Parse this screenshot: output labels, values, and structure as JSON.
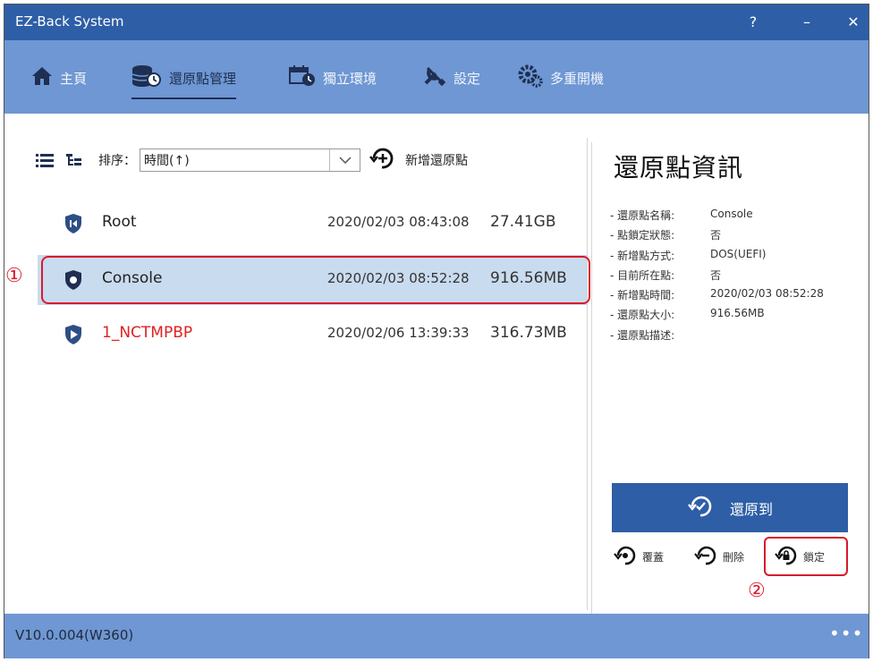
{
  "window": {
    "title": "EZ-Back System",
    "help_label": "?",
    "minimize_label": "–",
    "close_label": "✕"
  },
  "nav": {
    "items": [
      {
        "label": "主頁",
        "icon": "home-icon"
      },
      {
        "label": "還原點管理",
        "icon": "database-restore-icon"
      },
      {
        "label": "獨立環境",
        "icon": "calendar-icon"
      },
      {
        "label": "設定",
        "icon": "tools-icon"
      },
      {
        "label": "多重開機",
        "icon": "gears-icon"
      }
    ],
    "active": "還原點管理"
  },
  "toolbar": {
    "sort_label": "排序：",
    "sort_value": "時間(↑)",
    "add_label": "新增還原點"
  },
  "restore_points": [
    {
      "name": "Root",
      "time": "2020/02/03 08:43:08",
      "size": "27.41GB",
      "color": "#222222"
    },
    {
      "name": "Console",
      "time": "2020/02/03 08:52:28",
      "size": "916.56MB",
      "selected": true,
      "color": "#222222"
    },
    {
      "name": "1_NCTMPBP",
      "time": "2020/02/06 13:39:33",
      "size": "316.73MB",
      "color": "#e02020"
    }
  ],
  "info": {
    "title": "還原點資訊",
    "rows": [
      {
        "key": "- 還原點名稱:",
        "value": "Console"
      },
      {
        "key": "- 點鎖定狀態:",
        "value": "否"
      },
      {
        "key": "- 新增點方式:",
        "value": "DOS(UEFI)"
      },
      {
        "key": "- 目前所在點:",
        "value": "否"
      },
      {
        "key": "- 新增點時間:",
        "value": "2020/02/03 08:52:28"
      },
      {
        "key": "- 還原點大小:",
        "value": "916.56MB"
      },
      {
        "key": "- 還原點描述:",
        "value": ""
      }
    ]
  },
  "actions": {
    "restore_label": "還原到",
    "overwrite_label": "覆蓋",
    "delete_label": "刪除",
    "lock_label": "鎖定"
  },
  "annotations": {
    "marker_1": "①",
    "marker_2": "②"
  },
  "footer": {
    "version": "V10.0.004(W360)",
    "more_label": "•••"
  },
  "colors": {
    "titlebar": "#2e5ea6",
    "navbar": "#6e97d3",
    "selected_row": "#c9dbef",
    "highlight": "#d8192c"
  }
}
